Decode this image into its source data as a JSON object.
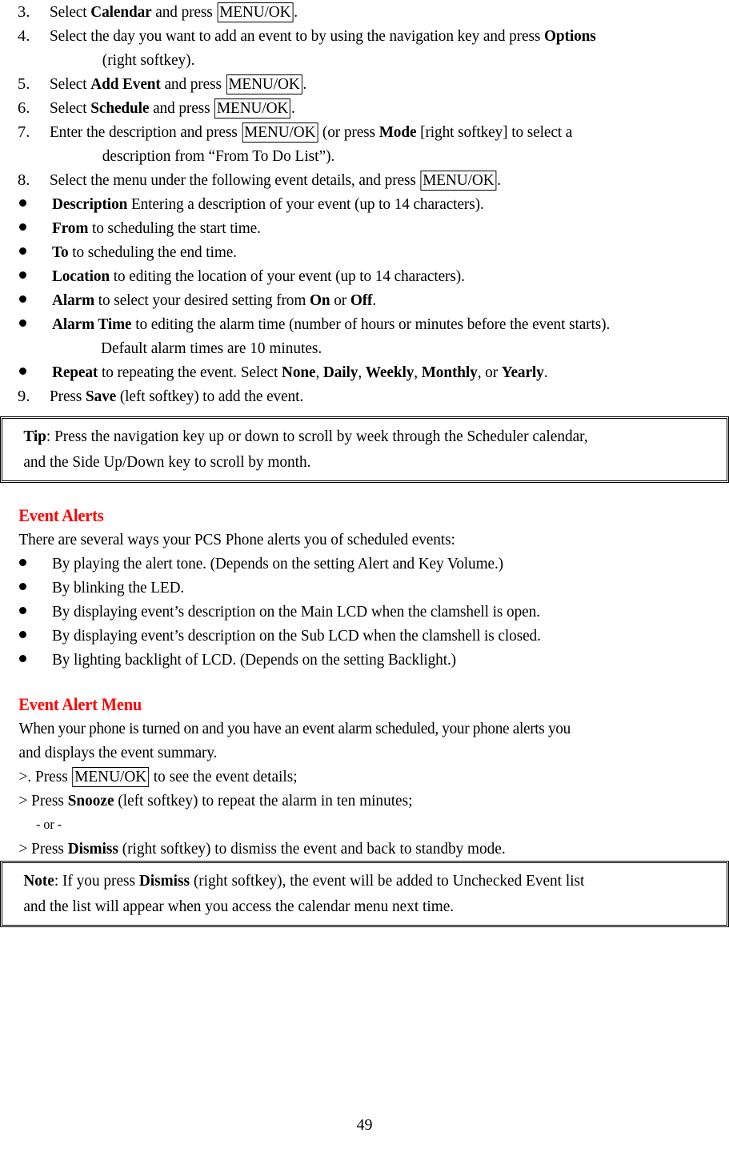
{
  "document": {
    "page_number": "49"
  },
  "colors": {
    "heading_red": "#FF0000",
    "text_black": "#000000",
    "box_border": "#000000"
  },
  "key_labels": {
    "menu_ok": "MENU/OK"
  },
  "steps": {
    "items": [
      {
        "number": "3.",
        "segments": [
          {
            "text": "Select ",
            "style": "normal"
          },
          {
            "text": "Calendar",
            "style": "bold"
          },
          {
            "text": " and press ",
            "style": "normal"
          },
          {
            "text": "MENU/OK",
            "style": "keybox"
          },
          {
            "text": ".",
            "style": "normal"
          }
        ]
      },
      {
        "number": "4.",
        "segments": [
          {
            "text": "Select the day you want to add an event to by using the navigation key and press ",
            "style": "normal"
          },
          {
            "text": "Options",
            "style": "bold"
          }
        ],
        "continuation": [
          {
            "text": "(right softkey).",
            "style": "normal"
          }
        ]
      },
      {
        "number": "5.",
        "segments": [
          {
            "text": "Select ",
            "style": "normal"
          },
          {
            "text": "Add Event",
            "style": "bold"
          },
          {
            "text": " and press ",
            "style": "normal"
          },
          {
            "text": "MENU/OK",
            "style": "keybox"
          },
          {
            "text": ".",
            "style": "normal"
          }
        ]
      },
      {
        "number": "6.",
        "segments": [
          {
            "text": "Select ",
            "style": "normal"
          },
          {
            "text": "Schedule",
            "style": "bold"
          },
          {
            "text": " and press ",
            "style": "normal"
          },
          {
            "text": "MENU/OK",
            "style": "keybox"
          },
          {
            "text": ".",
            "style": "normal"
          }
        ]
      },
      {
        "number": "7.",
        "segments": [
          {
            "text": "Enter the description and press ",
            "style": "normal"
          },
          {
            "text": "MENU/OK",
            "style": "keybox"
          },
          {
            "text": " (or press ",
            "style": "normal"
          },
          {
            "text": "Mode",
            "style": "bold"
          },
          {
            "text": " [right softkey] to select a",
            "style": "normal"
          }
        ],
        "continuation": [
          {
            "text": "description from “From To Do List”).",
            "style": "normal"
          }
        ]
      },
      {
        "number": "8.",
        "segments": [
          {
            "text": "Select the menu under the following event details, and press ",
            "style": "normal"
          },
          {
            "text": "MENU/OK",
            "style": "keybox"
          },
          {
            "text": ".",
            "style": "normal"
          }
        ]
      }
    ]
  },
  "event_details": {
    "items": [
      {
        "segments": [
          {
            "text": "Description",
            "style": "bold"
          },
          {
            "text": " Entering a description of your event (up to 14 characters).",
            "style": "normal"
          }
        ]
      },
      {
        "segments": [
          {
            "text": "From",
            "style": "bold"
          },
          {
            "text": " to scheduling the start time.",
            "style": "normal"
          }
        ]
      },
      {
        "segments": [
          {
            "text": "To",
            "style": "bold"
          },
          {
            "text": " to scheduling the end time.",
            "style": "normal"
          }
        ]
      },
      {
        "segments": [
          {
            "text": "Location",
            "style": "bold"
          },
          {
            "text": " to editing the location of your event (up to 14 characters).",
            "style": "normal"
          }
        ]
      },
      {
        "segments": [
          {
            "text": "Alarm",
            "style": "bold"
          },
          {
            "text": " to select your desired setting from ",
            "style": "normal"
          },
          {
            "text": "On",
            "style": "bold"
          },
          {
            "text": " or ",
            "style": "normal"
          },
          {
            "text": "Off",
            "style": "bold"
          },
          {
            "text": ".",
            "style": "normal"
          }
        ]
      },
      {
        "segments": [
          {
            "text": "Alarm Time",
            "style": "bold"
          },
          {
            "text": " to editing the alarm time (number of hours or minutes before the event starts).",
            "style": "normal"
          }
        ],
        "continuation": [
          {
            "text": "Default alarm times are 10 minutes.",
            "style": "normal"
          }
        ]
      },
      {
        "segments": [
          {
            "text": "Repeat",
            "style": "bold"
          },
          {
            "text": " to repeating the event. Select ",
            "style": "normal"
          },
          {
            "text": "None",
            "style": "bold"
          },
          {
            "text": ", ",
            "style": "normal"
          },
          {
            "text": "Daily",
            "style": "bold"
          },
          {
            "text": ", ",
            "style": "normal"
          },
          {
            "text": "Weekly",
            "style": "bold"
          },
          {
            "text": ", ",
            "style": "normal"
          },
          {
            "text": "Monthly",
            "style": "bold"
          },
          {
            "text": ", or ",
            "style": "normal"
          },
          {
            "text": "Yearly",
            "style": "bold"
          },
          {
            "text": ".",
            "style": "normal"
          }
        ]
      }
    ]
  },
  "final_step": {
    "number": "9.",
    "segments": [
      {
        "text": "Press ",
        "style": "normal"
      },
      {
        "text": "Save",
        "style": "bold"
      },
      {
        "text": " (left softkey) to add the event.",
        "style": "normal"
      }
    ]
  },
  "tip_box": {
    "lines": [
      [
        {
          "text": "Tip",
          "style": "bold"
        },
        {
          "text": ": Press the navigation key up or down to scroll by week through the Scheduler calendar,",
          "style": "normal"
        }
      ],
      [
        {
          "text": "and the Side Up/Down key to scroll by month.",
          "style": "normal"
        }
      ]
    ]
  },
  "event_alerts": {
    "heading": "Event Alerts",
    "intro": "There are several ways your PCS Phone alerts you of scheduled events:",
    "items": [
      "By playing the alert tone. (Depends on the setting Alert and Key Volume.)",
      "By blinking the LED.",
      "By displaying event’s description on the Main LCD when the clamshell is open.",
      "By displaying event’s description on the Sub LCD when the clamshell is closed.",
      "By lighting backlight of LCD. (Depends on the setting Backlight.)"
    ]
  },
  "event_alert_menu": {
    "heading": "Event Alert Menu",
    "paragraph_lines": [
      "When your phone is turned on and you have an event alarm scheduled, your phone alerts you",
      "and displays the event summary."
    ],
    "actions": [
      {
        "segments": [
          {
            "text": ">. Press ",
            "style": "normal"
          },
          {
            "text": "MENU/OK",
            "style": "keybox"
          },
          {
            "text": " to see the event details;",
            "style": "normal"
          }
        ]
      },
      {
        "segments": [
          {
            "text": "> Press ",
            "style": "normal"
          },
          {
            "text": "Snooze",
            "style": "bold"
          },
          {
            "text": " (left softkey) to repeat the alarm in ten minutes;",
            "style": "normal"
          }
        ]
      }
    ],
    "or_separator": "- or -",
    "final_action": {
      "segments": [
        {
          "text": "> Press ",
          "style": "normal"
        },
        {
          "text": "Dismiss",
          "style": "bold"
        },
        {
          "text": " (right softkey) to dismiss the event and back to standby mode.",
          "style": "normal"
        }
      ]
    }
  },
  "note_box": {
    "lines": [
      [
        {
          "text": "Note",
          "style": "bold"
        },
        {
          "text": ": If you press ",
          "style": "normal"
        },
        {
          "text": "Dismiss",
          "style": "bold"
        },
        {
          "text": " (right softkey), the event will be added to Unchecked Event list",
          "style": "normal"
        }
      ],
      [
        {
          "text": "and the list will appear when you access the calendar menu next time.",
          "style": "normal"
        }
      ]
    ]
  }
}
